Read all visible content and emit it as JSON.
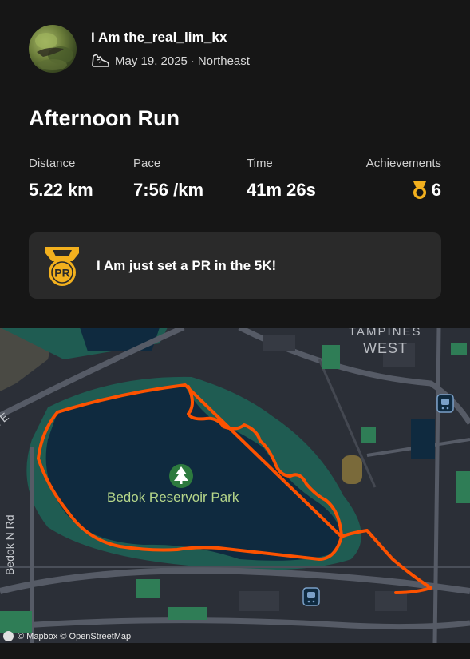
{
  "athlete": {
    "name": "I Am the_real_lim_kx",
    "date": "May 19, 2025",
    "separator": "·",
    "location": "Northeast"
  },
  "activity": {
    "title": "Afternoon Run",
    "stats": {
      "distance": {
        "label": "Distance",
        "value": "5.22 km"
      },
      "pace": {
        "label": "Pace",
        "value": "7:56 /km"
      },
      "time": {
        "label": "Time",
        "value": "41m 26s"
      },
      "achievements": {
        "label": "Achievements",
        "value": "6"
      }
    },
    "pr_message": "I Am just set a PR in the 5K!",
    "pr_badge_text": "PR"
  },
  "map": {
    "park_name": "Bedok Reservoir Park",
    "area_name": "WEST",
    "area_name_top": "TAMPINES",
    "road_vertical": "Bedok N Rd",
    "road_diagonal": "d E",
    "attribution": "© Mapbox © OpenStreetMap",
    "route_color": "#fc5200",
    "water_color": "#0f2a3f",
    "park_color": "#1f5c52"
  },
  "colors": {
    "background": "#161616",
    "card": "#2a2a2a",
    "gold": "#f2b01e"
  },
  "icons": {
    "activity_type": "run-shoe-icon",
    "achievement": "medal-icon",
    "pr": "pr-medal-icon",
    "park": "tree-icon",
    "transit": "train-station-icon"
  }
}
